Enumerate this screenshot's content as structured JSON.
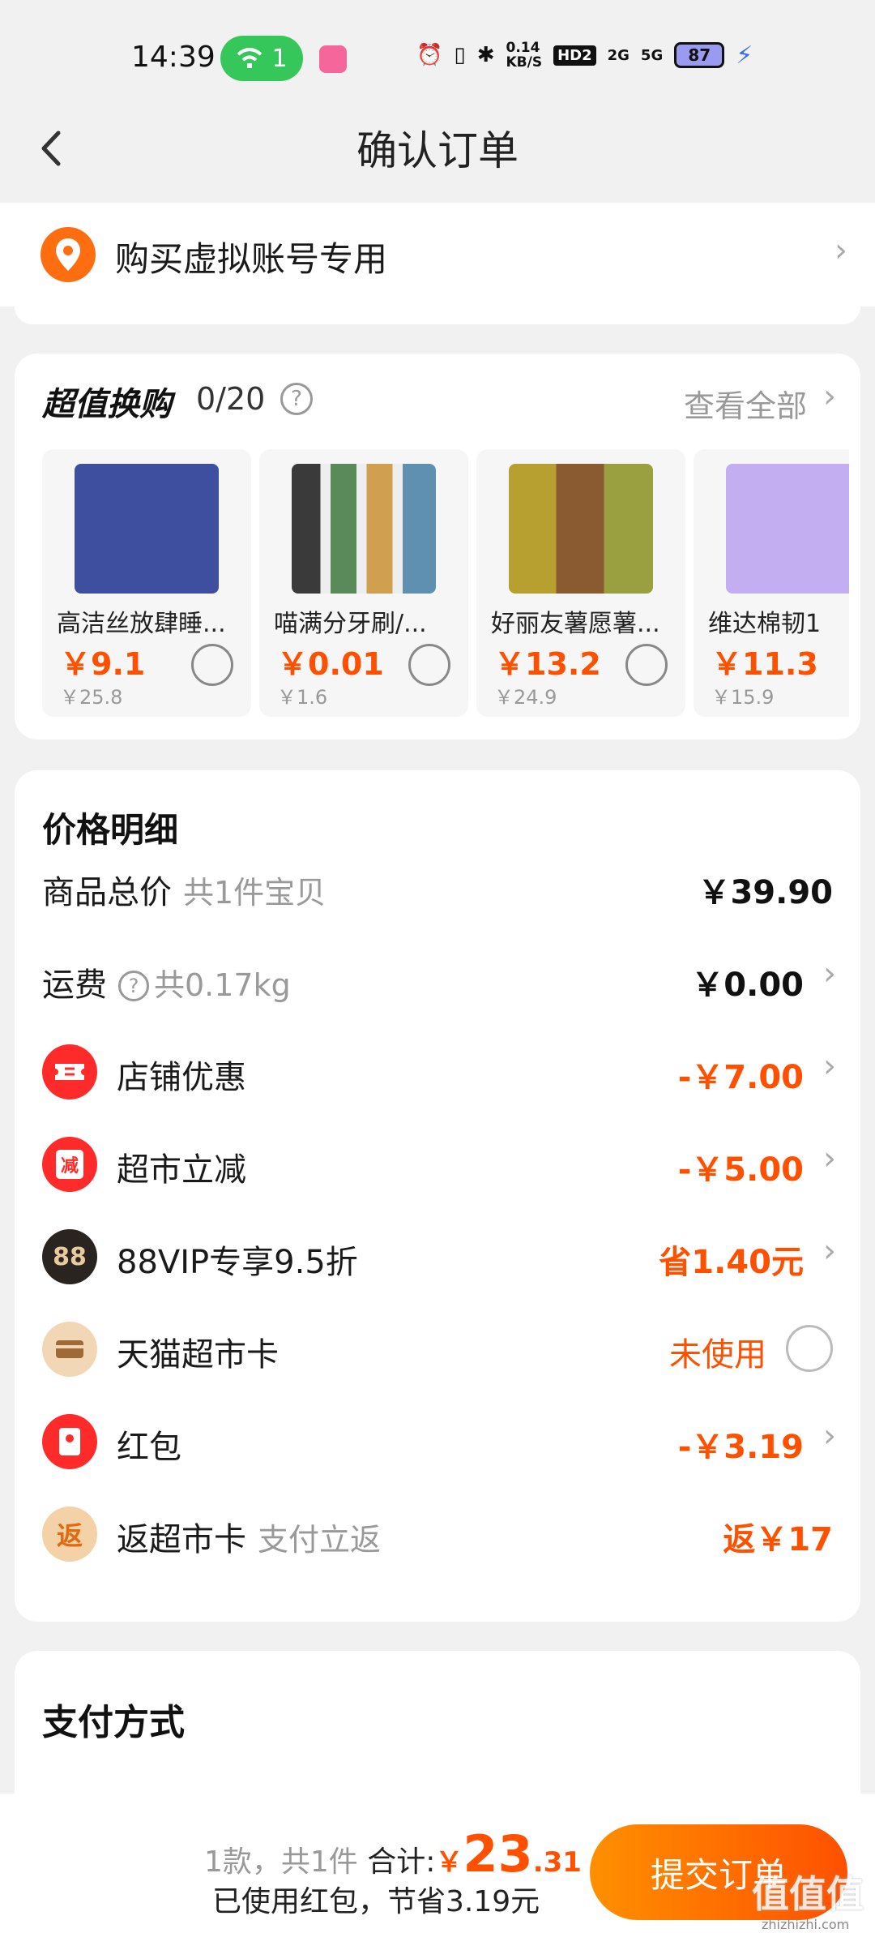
{
  "status_bar": {
    "time": "14:39",
    "wifi_badge": "1",
    "speed_top": "0.14",
    "speed_bottom": "KB/S",
    "hd": "HD2",
    "net1": "2G",
    "net2": "5G",
    "battery": "87"
  },
  "header": {
    "title": "确认订单"
  },
  "address": {
    "text": "购买虚拟账号专用"
  },
  "exchange": {
    "title": "超值换购",
    "count": "0/20",
    "view_all": "查看全部",
    "products": [
      {
        "name": "高洁丝放肆睡...",
        "price": "￥9.1",
        "orig": "￥25.8",
        "color": "#3d4f9e"
      },
      {
        "name": "喵满分牙刷/...",
        "price": "￥0.01",
        "orig": "￥1.6",
        "color": "#3a3a3a"
      },
      {
        "name": "好丽友薯愿薯...",
        "price": "￥13.2",
        "orig": "￥24.9",
        "color": "#b8a030"
      },
      {
        "name": "维达棉韧1",
        "price": "￥11.3",
        "orig": "￥15.9",
        "color": "#a88be0"
      }
    ]
  },
  "price_detail": {
    "title": "价格明细",
    "rows": [
      {
        "label": "商品总价",
        "sub": "共1件宝贝",
        "value": "￥39.90"
      },
      {
        "label": "运费",
        "help": "?",
        "sub": "共0.17kg",
        "value": "￥0.00"
      },
      {
        "label": "店铺优惠",
        "value": "-￥7.00",
        "icon": "coupon-icon",
        "icon_color": "#ff2a2a"
      },
      {
        "label": "超市立减",
        "value": "-￥5.00",
        "icon": "discount-icon",
        "icon_text": "减",
        "icon_color": "#ff2a2a"
      },
      {
        "label": "88VIP专享9.5折",
        "value": "省1.40元",
        "icon": "vip-88-icon",
        "icon_text": "88",
        "icon_color": "#2a2420"
      },
      {
        "label": "天猫超市卡",
        "value": "未使用",
        "icon": "card-icon",
        "icon_color": "#f2d7b6"
      },
      {
        "label": "红包",
        "value": "-￥3.19",
        "icon": "red-packet-icon",
        "icon_color": "#ff2a2a"
      },
      {
        "label": "返超市卡",
        "sub": "支付立返",
        "value": "返￥17",
        "icon": "rebate-icon",
        "icon_text": "返",
        "icon_color": "#f4d2a8"
      }
    ]
  },
  "payment": {
    "title": "支付方式"
  },
  "bottom": {
    "count": "1款，共1件",
    "total_label": "合计:",
    "currency": "￥",
    "total_big": "23",
    "total_small": ".31",
    "saved": "已使用红包，节省3.19元",
    "submit": "提交订单",
    "watermark": "值值值",
    "watermark_sub": "zhizhizhi.com"
  },
  "colors": {
    "accent": "#ff5000",
    "red": "#ff2a2a",
    "bg": "#f1f1f1"
  }
}
